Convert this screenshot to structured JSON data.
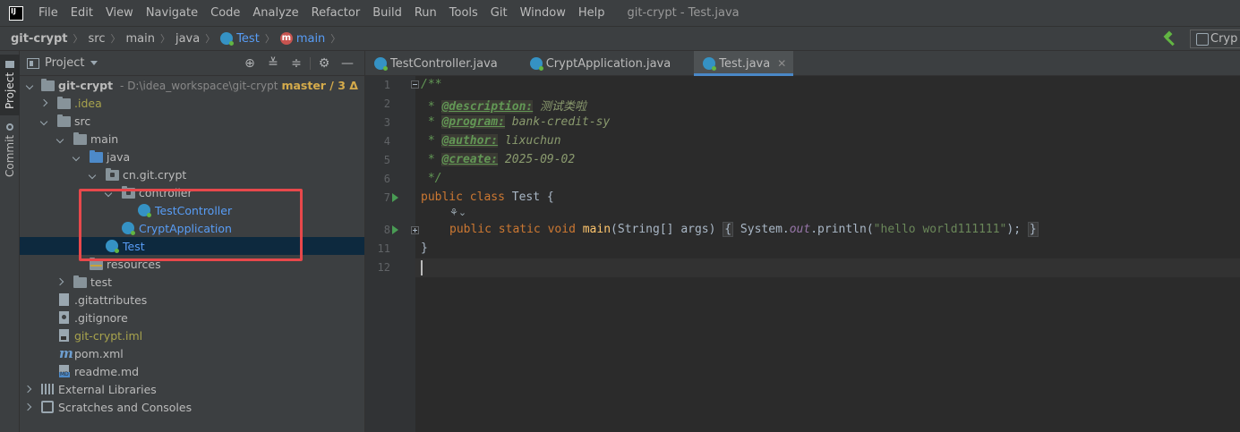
{
  "menu": {
    "items": [
      "File",
      "Edit",
      "View",
      "Navigate",
      "Code",
      "Analyze",
      "Refactor",
      "Build",
      "Run",
      "Tools",
      "Git",
      "Window",
      "Help"
    ],
    "window_title": "git-crypt - Test.java"
  },
  "breadcrumbs": {
    "project": "git-crypt",
    "src": "src",
    "main": "main",
    "java": "java",
    "file": "Test",
    "method": "main"
  },
  "run_config": {
    "label": "Cryp"
  },
  "left_strip": {
    "project_tab": "Project",
    "commit_tab": "Commit"
  },
  "project_panel": {
    "title": "Project",
    "root": {
      "name": "git-crypt",
      "path": "- D:\\idea_workspace\\git-crypt",
      "branch": "master / 3 Δ"
    },
    "items": {
      "idea": ".idea",
      "src": "src",
      "main": "main",
      "java": "java",
      "package": "cn.git.crypt",
      "controller": "controller",
      "test_controller": "TestController",
      "crypt_application": "CryptApplication",
      "test": "Test",
      "resources": "resources",
      "test_folder": "test",
      "gitattributes": ".gitattributes",
      "gitignore": ".gitignore",
      "iml": "git-crypt.iml",
      "pom": "pom.xml",
      "readme": "readme.md",
      "external_libraries": "External Libraries",
      "scratches": "Scratches and Consoles"
    }
  },
  "editor_tabs": [
    {
      "label": "TestController.java",
      "active": false
    },
    {
      "label": "CryptApplication.java",
      "active": false
    },
    {
      "label": "Test.java",
      "active": true
    }
  ],
  "editor": {
    "line_numbers": [
      "1",
      "2",
      "3",
      "4",
      "5",
      "6",
      "7",
      "8",
      "11",
      "12"
    ],
    "comment_open": "/**",
    "comment_star": " * ",
    "desc_tag": "@description:",
    "desc_val": " 测试类啦",
    "program_tag": "@program:",
    "program_val": " bank-credit-sy",
    "author_tag": "@author:",
    "author_val": " lixuchun",
    "create_tag": "@create:",
    "create_val": " 2025-09-02",
    "comment_close": " */",
    "kw_public": "public",
    "kw_class": " class",
    "class_decl": " Test {",
    "kw_static": " static",
    "kw_void": " void",
    "main_name": " main",
    "main_params": "(String[] args) ",
    "fold_open": "{",
    "sys_out_prefix": " System.",
    "out_field": "out",
    "println_call": ".println(",
    "hello_string": "\"hello world111111\"",
    "call_end": "); ",
    "fold_close": "}",
    "class_close": "}"
  }
}
